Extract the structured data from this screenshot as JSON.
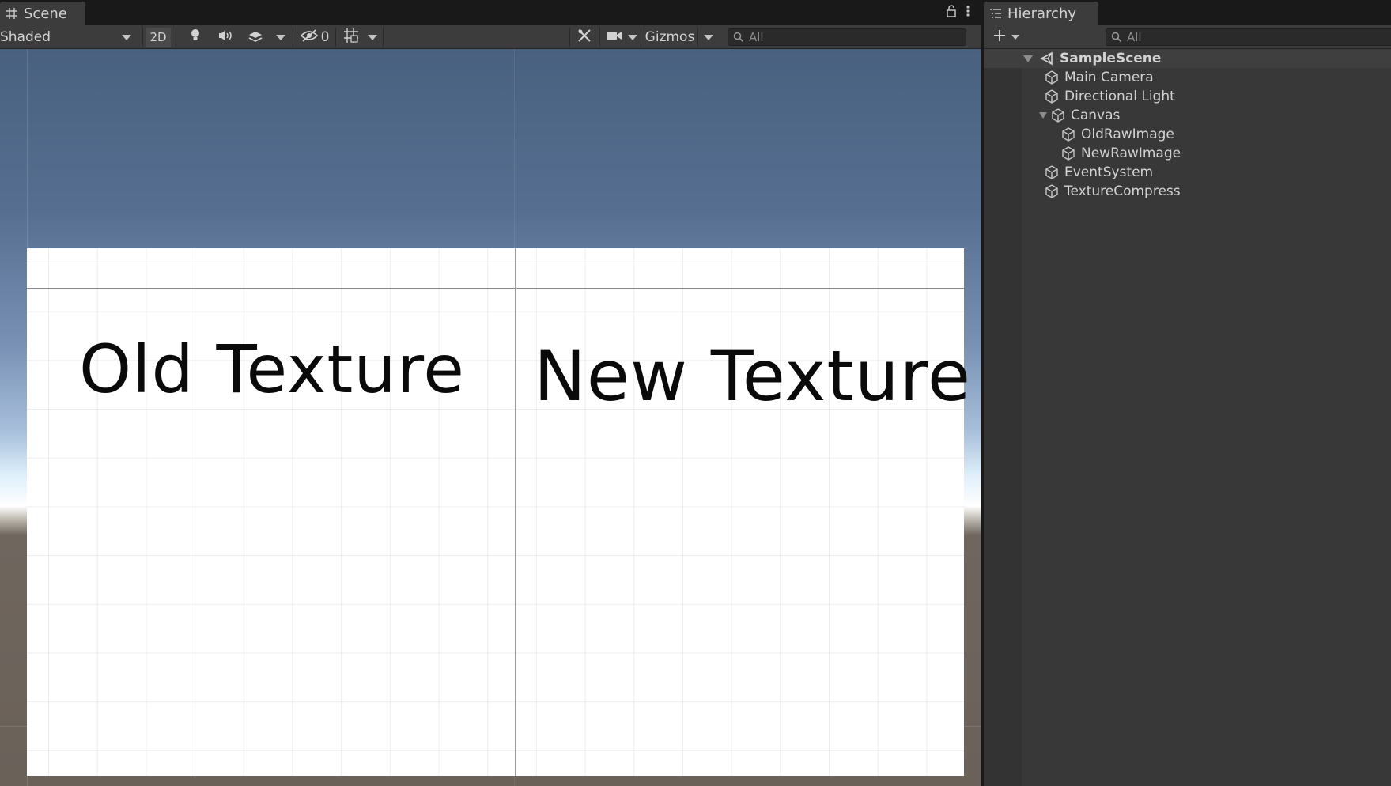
{
  "scene_panel": {
    "tab_label": "Scene",
    "tab_icon": "grid-icon",
    "shading_mode": "Shaded",
    "mode_2d_label": "2D",
    "hidden_count": "0",
    "gizmos_label": "Gizmos",
    "search_placeholder": "All",
    "canvas": {
      "left_label": "Old Texture",
      "right_label": "New Texture"
    }
  },
  "hierarchy_panel": {
    "tab_label": "Hierarchy",
    "tab_icon": "list-icon",
    "search_placeholder": "All",
    "scene": "SampleScene",
    "items": [
      {
        "label": "Main Camera"
      },
      {
        "label": "Directional Light"
      },
      {
        "label": "Canvas",
        "expanded": true
      },
      {
        "label": "OldRawImage"
      },
      {
        "label": "NewRawImage"
      },
      {
        "label": "EventSystem"
      },
      {
        "label": "TextureCompress"
      }
    ]
  },
  "colors": {
    "editor_bg": "#383838",
    "toolbar_bg": "#3c3c3c",
    "text": "#d2d2d2"
  }
}
